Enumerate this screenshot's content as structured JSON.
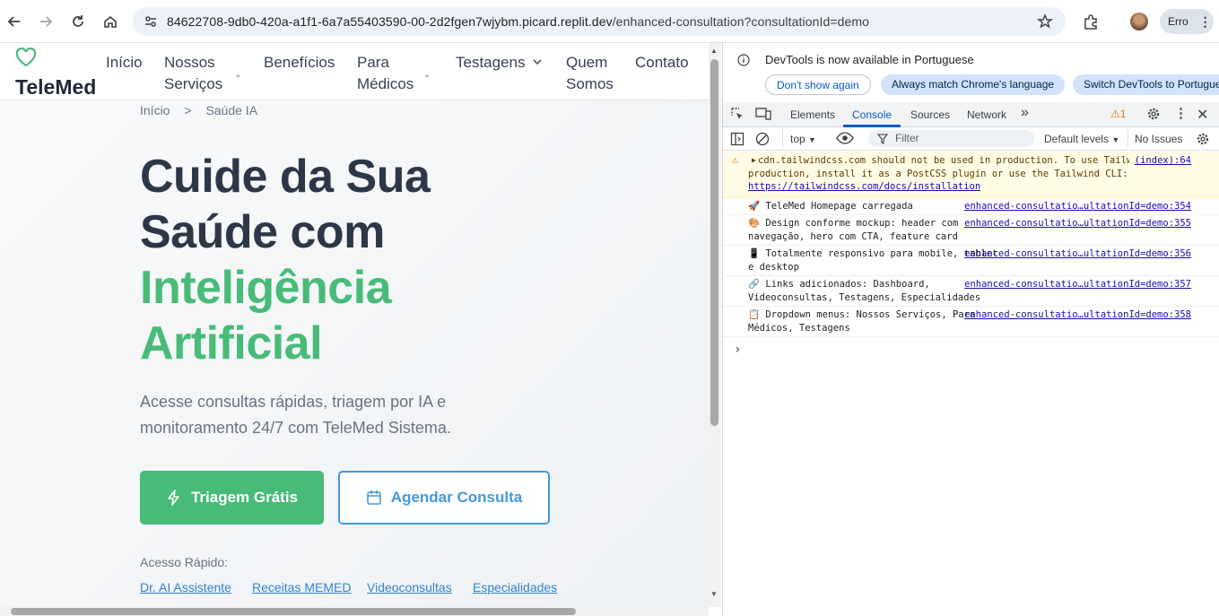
{
  "browser": {
    "url_host": "84622708-9db0-420a-a1f1-6a7a55403590-00-2d2fgen7wjybm.picard.replit.dev",
    "url_path": "/enhanced-consultation?consultationId=demo",
    "profile_label": "Erro"
  },
  "site": {
    "logo_text": "TeleMed",
    "nav": {
      "inicio": "Início",
      "servicos_1": "Nossos",
      "servicos_2": "Serviços",
      "beneficios": "Benefícios",
      "medicos_1": "Para",
      "medicos_2": "Médicos",
      "testagens": "Testagens",
      "quem_1": "Quem",
      "quem_2": "Somos",
      "contato": "Contato"
    },
    "breadcrumb": {
      "home": "Início",
      "separator": ">",
      "current": "Saúde IA"
    },
    "hero": {
      "line1": "Cuide da Sua",
      "line2": "Saúde com",
      "line3": "Inteligência",
      "line4": "Artificial",
      "subtitle": "Acesse consultas rápidas, triagem por IA e monitoramento 24/7 com TeleMed Sistema.",
      "btn_triagem": "Triagem Grátis",
      "btn_agendar": "Agendar Consulta"
    },
    "quick_access": {
      "label": "Acesso Rápido:",
      "links": [
        "Dr. AI Assistente",
        "Receitas MEMED",
        "Videoconsultas",
        "Especialidades"
      ]
    }
  },
  "devtools": {
    "notice": "DevTools is now available in Portuguese",
    "btn_dont_show": "Don't show again",
    "btn_match": "Always match Chrome's language",
    "btn_switch": "Switch DevTools to Portuguese",
    "tabs": {
      "elements": "Elements",
      "console": "Console",
      "sources": "Sources",
      "network": "Network"
    },
    "warn_count": "1",
    "toolbar": {
      "context": "top",
      "filter_placeholder": "Filter",
      "levels": "Default levels",
      "issues": "No Issues"
    },
    "messages": [
      {
        "text": "cdn.tailwindcss.com should not be used in production. To use Tailwind CSS in production, install it as a PostCSS plugin or use the Tailwind CLI: ",
        "link": "https://tailwindcss.com/docs/installation",
        "source": "(index):64"
      },
      {
        "icon": "🚀",
        "text": "TeleMed Homepage carregada",
        "source": "enhanced-consultatio…ultationId=demo:354"
      },
      {
        "icon": "🎨",
        "text": "Design conforme mockup: header com navegação, hero com CTA, feature card",
        "source": "enhanced-consultatio…ultationId=demo:355"
      },
      {
        "icon": "📱",
        "text": "Totalmente responsivo para mobile, tablet e desktop",
        "source": "enhanced-consultatio…ultationId=demo:356"
      },
      {
        "icon": "🔗",
        "text": "Links adicionados: Dashboard, Videoconsultas, Testagens, Especialidades",
        "source": "enhanced-consultatio…ultationId=demo:357"
      },
      {
        "icon": "📋",
        "text": "Dropdown menus: Nossos Serviços, Para Médicos, Testagens",
        "source": "enhanced-consultatio…ultationId=demo:358"
      }
    ],
    "prompt": "›"
  },
  "colors": {
    "brand_green": "#48bb78",
    "brand_blue": "#4299e1",
    "heading": "#2d3748"
  }
}
